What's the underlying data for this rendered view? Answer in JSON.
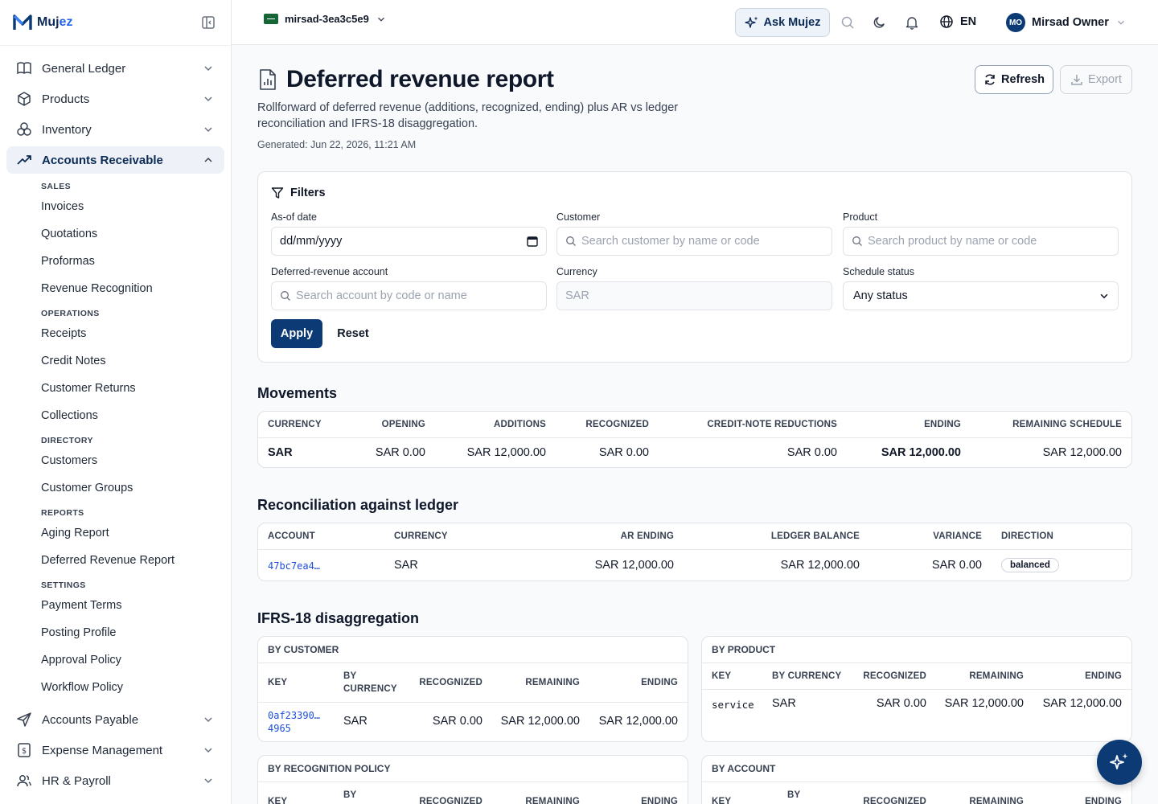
{
  "brand": {
    "name_a": "Muj",
    "name_b": "ez"
  },
  "topbar": {
    "org": "mirsad-3ea3c5e9",
    "ask": "Ask Mujez",
    "lang": "EN",
    "avatar": "MO",
    "user": "Mirsad Owner"
  },
  "sidebar": {
    "main": [
      {
        "label": "General Ledger",
        "icon": "book-icon"
      },
      {
        "label": "Products",
        "icon": "box-icon"
      },
      {
        "label": "Inventory",
        "icon": "boxes-icon"
      },
      {
        "label": "Accounts Receivable",
        "icon": "trending-up-icon"
      },
      {
        "label": "Accounts Payable",
        "icon": "send-icon"
      },
      {
        "label": "Expense Management",
        "icon": "receipt-icon"
      },
      {
        "label": "HR & Payroll",
        "icon": "users-icon"
      }
    ],
    "sections": {
      "sales": "SALES",
      "operations": "OPERATIONS",
      "directory": "DIRECTORY",
      "reports": "REPORTS",
      "settings": "SETTINGS"
    },
    "items": {
      "invoices": "Invoices",
      "quotations": "Quotations",
      "proformas": "Proformas",
      "revenue_recognition": "Revenue Recognition",
      "receipts": "Receipts",
      "credit_notes": "Credit Notes",
      "customer_returns": "Customer Returns",
      "collections": "Collections",
      "customers": "Customers",
      "customer_groups": "Customer Groups",
      "aging_report": "Aging Report",
      "deferred_revenue_report": "Deferred Revenue Report",
      "payment_terms": "Payment Terms",
      "posting_profile": "Posting Profile",
      "approval_policy": "Approval Policy",
      "workflow_policy": "Workflow Policy"
    }
  },
  "page": {
    "title": "Deferred revenue report",
    "description": "Rollforward of deferred revenue (additions, recognized, ending) plus AR vs ledger reconciliation and IFRS-18 disaggregation.",
    "generated": "Generated: Jun 22, 2026, 11:21 AM",
    "refresh": "Refresh",
    "export": "Export"
  },
  "filters": {
    "title": "Filters",
    "as_of_label": "As-of date",
    "as_of_value": "dd/mm/yyyy",
    "customer_label": "Customer",
    "customer_placeholder": "Search customer by name or code",
    "product_label": "Product",
    "product_placeholder": "Search product by name or code",
    "account_label": "Deferred-revenue account",
    "account_placeholder": "Search account by code or name",
    "currency_label": "Currency",
    "currency_placeholder": "SAR",
    "status_label": "Schedule status",
    "status_value": "Any status",
    "apply": "Apply",
    "reset": "Reset"
  },
  "movements": {
    "title": "Movements",
    "headers": [
      "CURRENCY",
      "OPENING",
      "ADDITIONS",
      "RECOGNIZED",
      "CREDIT-NOTE REDUCTIONS",
      "ENDING",
      "REMAINING SCHEDULE"
    ],
    "row": [
      "SAR",
      "SAR 0.00",
      "SAR 12,000.00",
      "SAR 0.00",
      "SAR 0.00",
      "SAR 12,000.00",
      "SAR 12,000.00"
    ]
  },
  "reconciliation": {
    "title": "Reconciliation against ledger",
    "headers": [
      "ACCOUNT",
      "CURRENCY",
      "AR ENDING",
      "LEDGER BALANCE",
      "VARIANCE",
      "DIRECTION"
    ],
    "row": [
      "47bc7ea4…",
      "SAR",
      "SAR 12,000.00",
      "SAR 12,000.00",
      "SAR 0.00",
      "balanced"
    ]
  },
  "ifrs": {
    "title": "IFRS-18 disaggregation",
    "by_customer": {
      "title": "BY CUSTOMER",
      "headers": [
        "KEY",
        "BY CURRENCY",
        "RECOGNIZED",
        "REMAINING",
        "ENDING"
      ],
      "row": [
        "0af23390…",
        "4965",
        "SAR",
        "SAR 0.00",
        "SAR 12,000.00",
        "SAR 12,000.00"
      ]
    },
    "by_product": {
      "title": "BY PRODUCT",
      "headers": [
        "KEY",
        "BY CURRENCY",
        "RECOGNIZED",
        "REMAINING",
        "ENDING"
      ],
      "row": [
        "service",
        "SAR",
        "SAR 0.00",
        "SAR 12,000.00",
        "SAR 12,000.00"
      ]
    },
    "by_policy": {
      "title": "BY RECOGNITION POLICY",
      "headers": [
        "KEY",
        "BY",
        "RECOGNIZED",
        "REMAINING",
        "ENDING"
      ]
    },
    "by_account": {
      "title": "BY ACCOUNT",
      "headers": [
        "KEY",
        "BY",
        "RECOGNIZED",
        "REMAINING",
        "ENDING"
      ]
    }
  }
}
